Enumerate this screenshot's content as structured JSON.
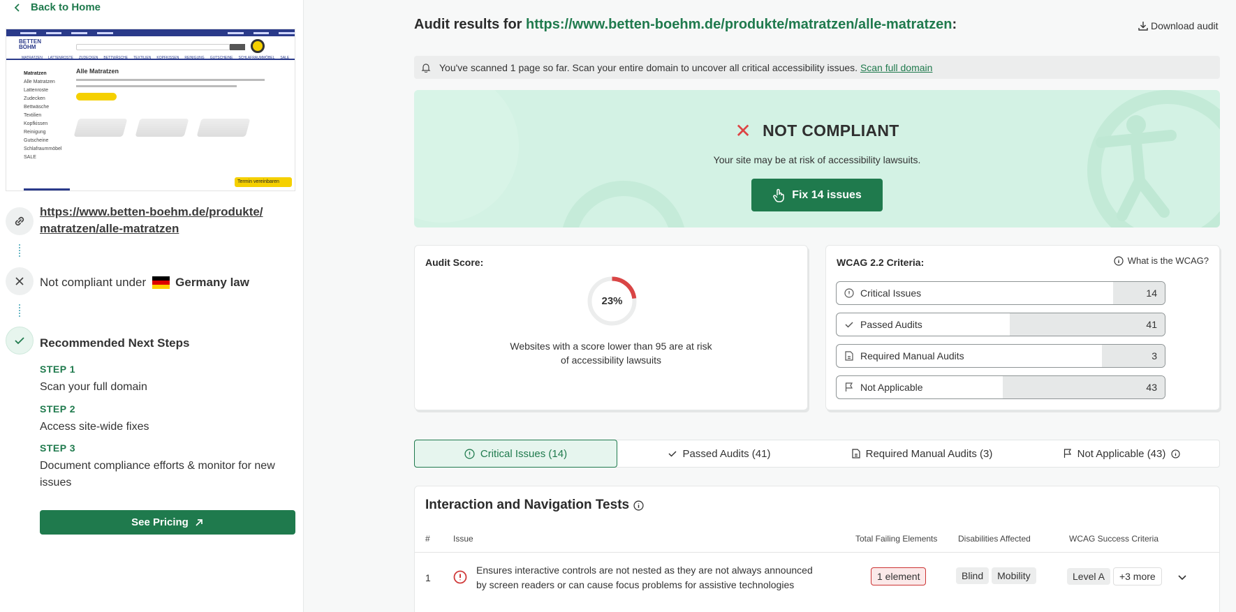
{
  "sidebar": {
    "back_label": "Back to Home",
    "url_line1": "https://www.betten-boehm.de/produkte/",
    "url_line2": "matratzen/alle-matratzen",
    "compliance_prefix": "Not compliant under",
    "compliance_law": "Germany law",
    "next_steps_title": "Recommended Next Steps",
    "steps": [
      {
        "label": "STEP 1",
        "text": "Scan your full domain"
      },
      {
        "label": "STEP 2",
        "text": "Access site-wide fixes"
      },
      {
        "label": "STEP 3",
        "text": "Document compliance efforts & monitor for new issues"
      }
    ],
    "pricing_label": "See Pricing",
    "preview": {
      "logo": "BETTEN BÖHM",
      "heading": "Alle Matratzen",
      "sidebar_items": [
        "Matratzen",
        "Alle Matratzen",
        "Lattenroste",
        "Zudecken",
        "Bettwäsche",
        "Textilien",
        "Kopfkissen",
        "Reinigung",
        "Gutscheine",
        "Schlafraummöbel",
        "SALE"
      ],
      "menu": [
        "MATRATZEN",
        "LATTENROSTE",
        "ZUDECKEN",
        "BETTWÄSCHE",
        "TEXTILIEN",
        "KOPFKISSEN",
        "REINIGUNG",
        "GUTSCHEINE",
        "SCHLAFRAUMMÖBEL",
        "SALE"
      ],
      "cta": "Termin vereinbaren"
    }
  },
  "header": {
    "title_prefix": "Audit results for",
    "title_url": "https://www.betten-boehm.de/produkte/matratzen/alle-matratzen",
    "title_suffix": ":",
    "download_label": "Download audit"
  },
  "notice": {
    "text": "You've scanned 1 page so far. Scan your entire domain to uncover all critical accessibility issues.",
    "link": "Scan full domain"
  },
  "hero": {
    "status": "NOT COMPLIANT",
    "risk_text": "Your site may be at risk of accessibility lawsuits.",
    "fix_label": "Fix 14 issues"
  },
  "score": {
    "title": "Audit Score:",
    "value": 23,
    "value_label": "23%",
    "text_line1": "Websites with a score lower than 95 are at risk",
    "text_line2": "of accessibility lawsuits"
  },
  "wcag": {
    "title": "WCAG 2.2 Criteria:",
    "link": "What is the WCAG?",
    "rows": [
      {
        "label": "Critical Issues",
        "count": "14",
        "icon": "alert-circle-icon"
      },
      {
        "label": "Passed Audits",
        "count": "41",
        "icon": "check-icon"
      },
      {
        "label": "Required Manual Audits",
        "count": "3",
        "icon": "document-icon"
      },
      {
        "label": "Not Applicable",
        "count": "43",
        "icon": "flag-icon"
      }
    ]
  },
  "tabs": [
    {
      "label": "Critical Issues (14)",
      "active": true
    },
    {
      "label": "Passed Audits (41)"
    },
    {
      "label": "Required Manual Audits (3)"
    },
    {
      "label": "Not Applicable (43)"
    }
  ],
  "table": {
    "section_title": "Interaction and Navigation Tests",
    "columns": [
      "#",
      "Issue",
      "Total Failing Elements",
      "Disabilities Affected",
      "WCAG Success Criteria"
    ],
    "rows": [
      {
        "num": "1",
        "issue_line1": "Ensures interactive controls are not nested as they are not always announced",
        "issue_line2": "by screen readers or can cause focus problems for assistive technologies",
        "failing": "1 element",
        "disabilities": [
          "Blind",
          "Mobility"
        ],
        "criteria": "Level A",
        "more": "+3 more"
      }
    ]
  },
  "colors": {
    "accent": "#1f7a4d",
    "hero_bg": "#d3f2e4",
    "danger": "#d44444"
  }
}
